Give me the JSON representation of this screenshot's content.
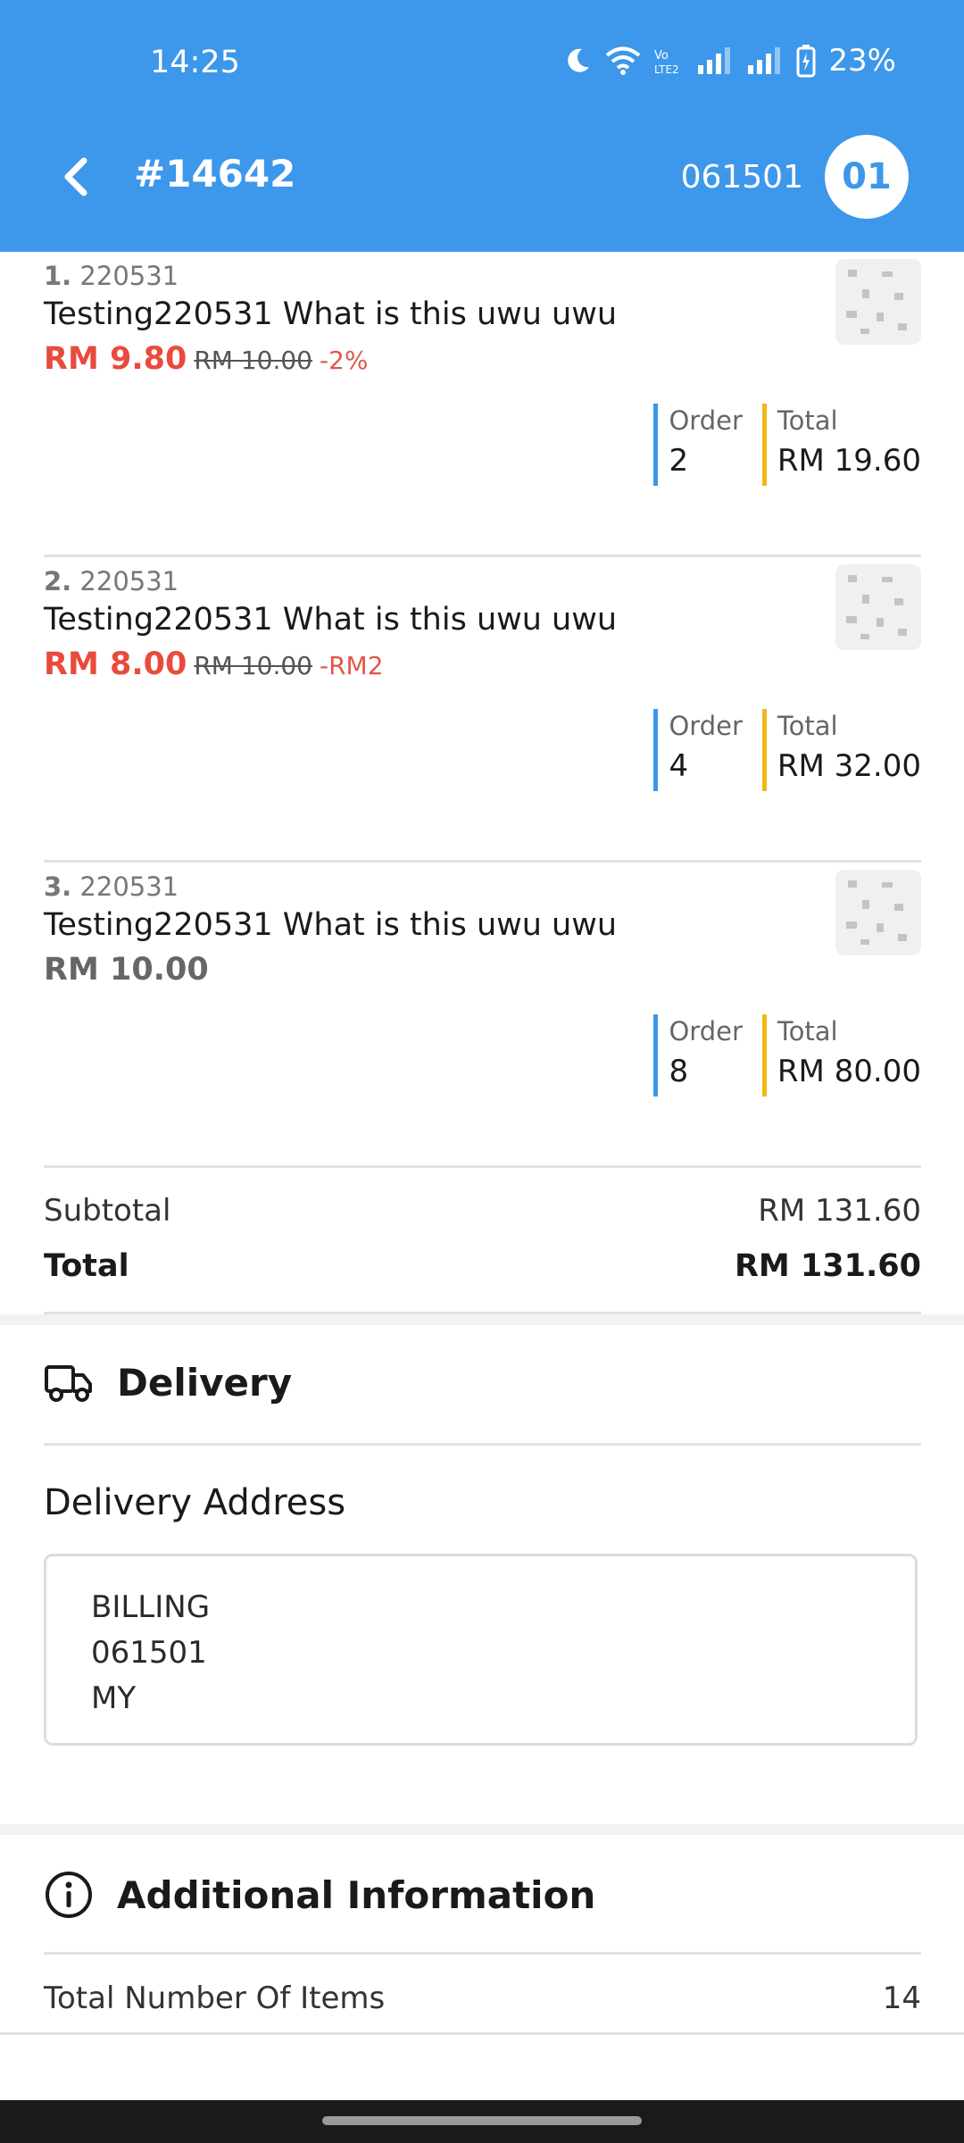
{
  "status_bar": {
    "time": "14:25",
    "battery": "23%"
  },
  "header": {
    "order_number": "#14642",
    "customer_code": "061501",
    "table_badge": "01"
  },
  "items": [
    {
      "index": "1.",
      "code": "220531",
      "name": "Testing220531 What is this uwu uwu",
      "price": "RM 9.80",
      "original_price": "RM 10.00",
      "discount": "-2%",
      "order_label": "Order",
      "order_qty": "2",
      "total_label": "Total",
      "total": "RM 19.60"
    },
    {
      "index": "2.",
      "code": "220531",
      "name": "Testing220531 What is this uwu uwu",
      "price": "RM 8.00",
      "original_price": "RM 10.00",
      "discount": "-RM2",
      "order_label": "Order",
      "order_qty": "4",
      "total_label": "Total",
      "total": "RM 32.00"
    },
    {
      "index": "3.",
      "code": "220531",
      "name": "Testing220531 What is this uwu uwu",
      "price": "RM 10.00",
      "order_label": "Order",
      "order_qty": "8",
      "total_label": "Total",
      "total": "RM 80.00"
    }
  ],
  "summary": {
    "subtotal_label": "Subtotal",
    "subtotal": "RM 131.60",
    "total_label": "Total",
    "total": "RM 131.60"
  },
  "delivery": {
    "heading": "Delivery",
    "address_title": "Delivery Address",
    "address_lines": [
      "BILLING",
      "061501",
      "MY"
    ]
  },
  "additional": {
    "heading": "Additional Information",
    "items_label": "Total Number Of Items",
    "items_count": "14"
  },
  "colors": {
    "primary": "#3d97ea",
    "price_red": "#e84b3c",
    "order_bar": "#3d97ea",
    "total_bar": "#f2b81a"
  },
  "icons": [
    "moon-icon",
    "wifi-icon",
    "volte-icon",
    "signal-icon",
    "battery-icon",
    "back-arrow-icon",
    "truck-icon",
    "info-icon"
  ]
}
